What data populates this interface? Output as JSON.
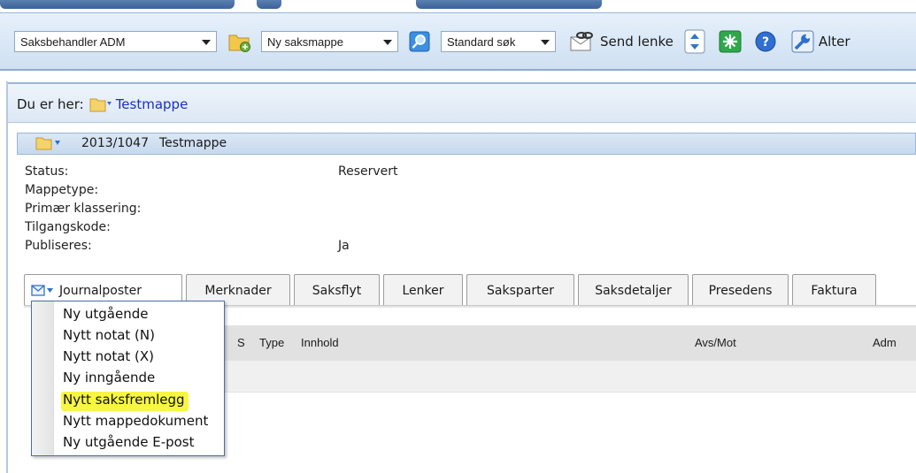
{
  "toolbar": {
    "role_select": "Saksbehandler ADM",
    "new_select": "Ny saksmappe",
    "search_select": "Standard søk",
    "send_link": "Send lenke",
    "alter_label": "Alter"
  },
  "breadcrumb": {
    "prefix": "Du er her:",
    "link": "Testmappe"
  },
  "case": {
    "number": "2013/1047",
    "title": "Testmappe"
  },
  "details": [
    {
      "label": "Status:",
      "value": "Reservert"
    },
    {
      "label": "Mappetype:",
      "value": ""
    },
    {
      "label": "Primær klassering:",
      "value": ""
    },
    {
      "label": "Tilgangskode:",
      "value": ""
    },
    {
      "label": "Publiseres:",
      "value": "Ja"
    }
  ],
  "tabs": [
    "Journalposter",
    "Merknader",
    "Saksflyt",
    "Lenker",
    "Saksparter",
    "Saksdetaljer",
    "Presedens",
    "Faktura"
  ],
  "grid_headers": [
    "S",
    "Type",
    "Innhold",
    "Avs/Mot",
    "Adm"
  ],
  "menu_items": [
    "Ny utgående",
    "Nytt notat (N)",
    "Nytt notat (X)",
    "Ny inngående",
    "Nytt saksfremlegg",
    "Nytt mappedokument",
    "Ny utgående E-post"
  ],
  "colors": {
    "highlight": "#f7f742",
    "link": "#1a2fc0",
    "toolbar": "#cfe0f2"
  }
}
